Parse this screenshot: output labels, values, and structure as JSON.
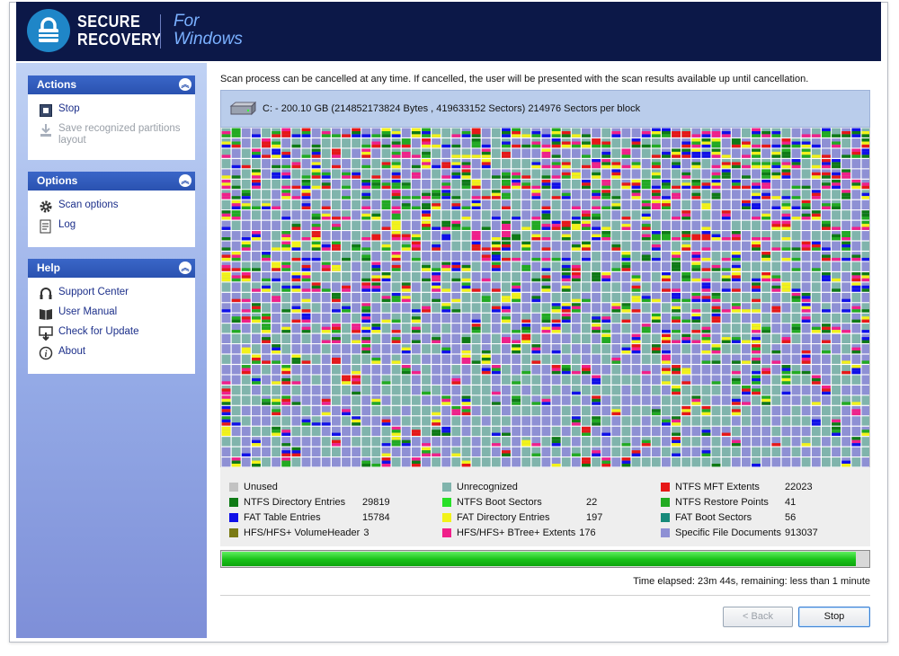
{
  "app": {
    "logo_line1": "SECURE",
    "logo_line2": "RECOVERY",
    "logo_for": "For",
    "logo_windows": "Windows",
    "brand_color": "#0c1848",
    "accent_color": "#1f86c8"
  },
  "sidebar": {
    "actions": {
      "title": "Actions",
      "items": [
        {
          "label": "Stop",
          "icon": "stop-icon",
          "enabled": true
        },
        {
          "label": "Save recognized partitions layout",
          "icon": "save-icon",
          "enabled": false
        }
      ]
    },
    "options": {
      "title": "Options",
      "items": [
        {
          "label": "Scan options",
          "icon": "gear-icon"
        },
        {
          "label": "Log",
          "icon": "log-icon"
        }
      ]
    },
    "help": {
      "title": "Help",
      "items": [
        {
          "label": "Support Center",
          "icon": "headset-icon"
        },
        {
          "label": "User Manual",
          "icon": "book-icon"
        },
        {
          "label": "Check for Update",
          "icon": "update-icon"
        },
        {
          "label": "About",
          "icon": "info-icon"
        }
      ]
    }
  },
  "main": {
    "info": "Scan process can be cancelled at any time. If cancelled, the user will be presented with the scan results available  up until cancellation.",
    "drive": "C: - 200.10 GB (214852173824 Bytes , 419633152 Sectors) 214976 Sectors per block"
  },
  "legend": [
    {
      "label": "Unused",
      "count": "",
      "color": "#c2c2c2"
    },
    {
      "label": "Unrecognized",
      "count": "",
      "color": "#80b4ac"
    },
    {
      "label": "NTFS MFT Extents",
      "count": "22023",
      "color": "#e61818"
    },
    {
      "label": "NTFS Directory Entries",
      "count": "29819",
      "color": "#0f7a16"
    },
    {
      "label": "NTFS Boot Sectors",
      "count": "22",
      "color": "#28e028"
    },
    {
      "label": "NTFS Restore Points",
      "count": "41",
      "color": "#22aa22"
    },
    {
      "label": "FAT Table Entries",
      "count": "15784",
      "color": "#1010e8"
    },
    {
      "label": "FAT Directory Entries",
      "count": "197",
      "color": "#f2f21a"
    },
    {
      "label": "FAT Boot Sectors",
      "count": "56",
      "color": "#168a7a"
    },
    {
      "label": "HFS/HFS+ VolumeHeader",
      "count": "3",
      "color": "#7a7a14"
    },
    {
      "label": "HFS/HFS+ BTree+ Extents",
      "count": "176",
      "color": "#f0208a"
    },
    {
      "label": "Specific File Documents",
      "count": "913037",
      "color": "#8e90d4"
    }
  ],
  "progress": {
    "value": 0.98
  },
  "status": {
    "time": "Time elapsed: 23m 44s, remaining: less than 1 minute"
  },
  "buttons": {
    "back": "< Back",
    "stop": "Stop"
  }
}
